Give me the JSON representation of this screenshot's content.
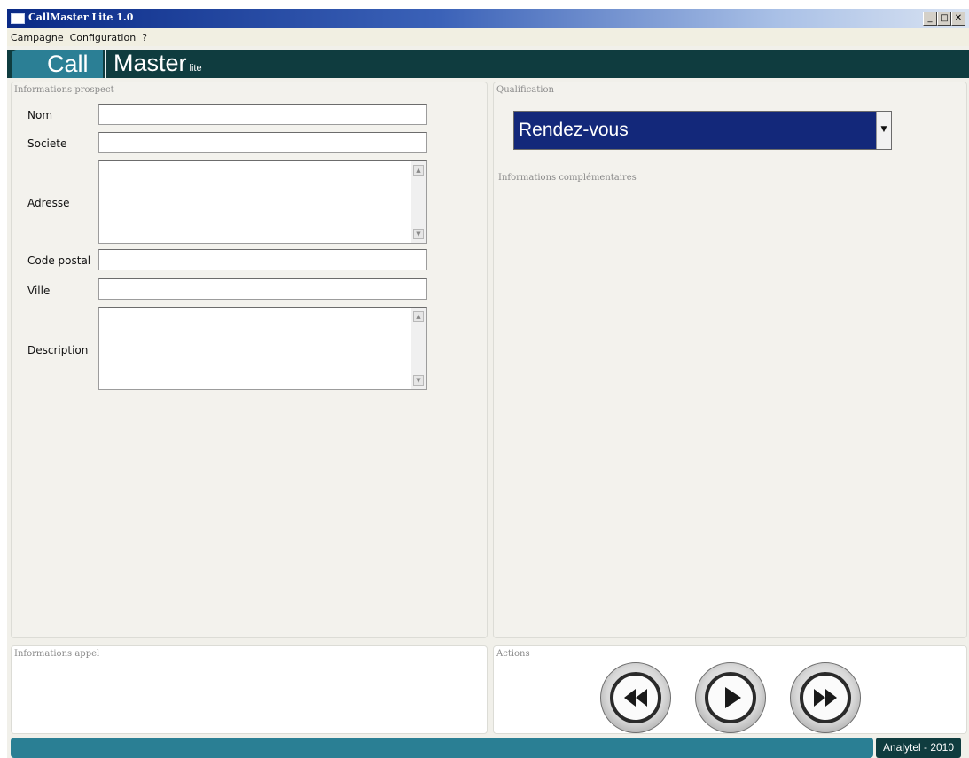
{
  "window": {
    "title": "CallMaster Lite 1.0"
  },
  "controls": {
    "minimize": "_",
    "maximize": "□",
    "close": "✕"
  },
  "menu": {
    "items": [
      "Campagne",
      "Configuration",
      "?"
    ]
  },
  "banner": {
    "call": "Call",
    "master": "Master",
    "lite": "lite"
  },
  "prospect": {
    "title": "Informations prospect",
    "fields": {
      "nom": "Nom",
      "societe": "Societe",
      "adresse": "Adresse",
      "code_postal": "Code postal",
      "ville": "Ville",
      "description": "Description"
    }
  },
  "qualification": {
    "title": "Qualification",
    "selected": "Rendez-vous",
    "extra_title": "Informations complémentaires"
  },
  "appel": {
    "title": "Informations appel"
  },
  "actions": {
    "title": "Actions",
    "icons": [
      "rewind-icon",
      "play-icon",
      "fast-forward-icon"
    ]
  },
  "status": {
    "brand": "Analytel - 2010"
  },
  "colors": {
    "banner_dark": "#0f3c3f",
    "banner_teal": "#2b7f95",
    "select_bg": "#13287a"
  }
}
